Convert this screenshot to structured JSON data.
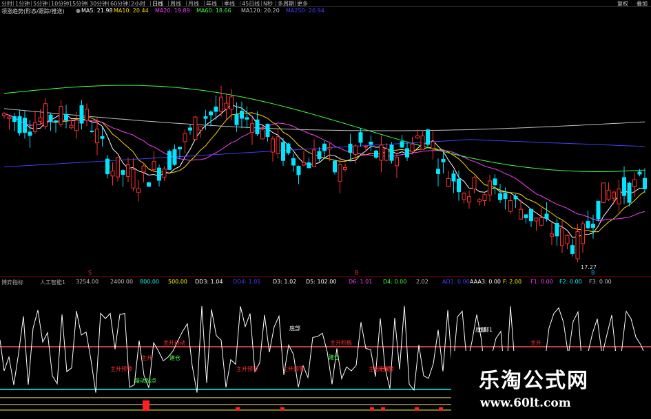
{
  "tabs": [
    "分时",
    "1分钟",
    "5分钟",
    "10分钟",
    "15分钟",
    "30分钟",
    "60分钟",
    "2小时",
    "日线",
    "周线",
    "月线",
    "年线",
    "季线",
    "45日线",
    "N秒",
    "多周期",
    "更多"
  ],
  "active_tab": "日线",
  "right_buttons": [
    "复权",
    "叠加"
  ],
  "info": {
    "title": "领涨趋势(形态/跟踪/推送)",
    "ma": [
      {
        "label": "MA5: 21.98",
        "color": "#ffffff"
      },
      {
        "label": "MA10: 20.44",
        "color": "#ffd700"
      },
      {
        "label": "MA20: 19.89",
        "color": "#ff40ff"
      },
      {
        "label": "MA60: 18.66",
        "color": "#40ff40"
      },
      {
        "label": "MA120: 20.20",
        "color": "#c0c0c0"
      },
      {
        "label": "MA250: 20.94",
        "color": "#4040ff"
      }
    ]
  },
  "main": {
    "low_label": "17.27",
    "bottom_marks": [
      "S",
      "B",
      "B"
    ]
  },
  "indicator": {
    "name": "博弈指标",
    "sub": "人工智能1",
    "items": [
      {
        "label": "3254.00",
        "color": "#c0c0c0"
      },
      {
        "label": "2400.00",
        "color": "#c0c0c0"
      },
      {
        "label": "800.00",
        "color": "#00ffff"
      },
      {
        "label": "500.00",
        "color": "#ffff00"
      },
      {
        "label": "DD3: 1.04",
        "color": "#ffffff"
      },
      {
        "label": "DD4: 1.01",
        "color": "#4040ff"
      },
      {
        "label": "D3: 1.02",
        "color": "#ffffff"
      },
      {
        "label": "D5: 102.00",
        "color": "#ffffff"
      },
      {
        "label": "D6: 1.01",
        "color": "#ff40ff"
      },
      {
        "label": "D4: 0.00",
        "color": "#40ff40"
      },
      {
        "label": "2.02",
        "color": "#c0c0c0"
      },
      {
        "label": "AD1: 0.00",
        "color": "#4040ff"
      },
      {
        "label": "AAA3: 0.00",
        "color": "#ffffff"
      },
      {
        "label": "F: 2.00",
        "color": "#ffff00"
      },
      {
        "label": "F1: 0.00",
        "color": "#ff40ff"
      },
      {
        "label": "F2: 0.00",
        "color": "#00ffff"
      },
      {
        "label": "F3: 0.00",
        "color": "#c0c0c0"
      }
    ],
    "annotations": [
      {
        "text": "底部",
        "color": "#ffffff"
      },
      {
        "text": "主升启动",
        "color": "#ff3030"
      },
      {
        "text": "主升",
        "color": "#ff3030"
      },
      {
        "text": "建仓",
        "color": "#40ff40"
      },
      {
        "text": "主升预警",
        "color": "#ff3030"
      },
      {
        "text": "主升预警",
        "color": "#ff3030"
      },
      {
        "text": "主升预警",
        "color": "#ff3030"
      },
      {
        "text": "慢动起点",
        "color": "#40ff40"
      },
      {
        "text": "主升积极",
        "color": "#ff3030"
      },
      {
        "text": "底部",
        "color": "#ffffff"
      },
      {
        "text": "建仓",
        "color": "#40ff40"
      },
      {
        "text": "主升启动",
        "color": "#ff3030"
      },
      {
        "text": "主升预警",
        "color": "#ff3030"
      },
      {
        "text": "底部1",
        "color": "#ffffff"
      },
      {
        "text": "主升",
        "color": "#ff3030"
      }
    ]
  },
  "watermark": {
    "title": "乐淘公式网",
    "url": "www.60lt.com"
  }
}
